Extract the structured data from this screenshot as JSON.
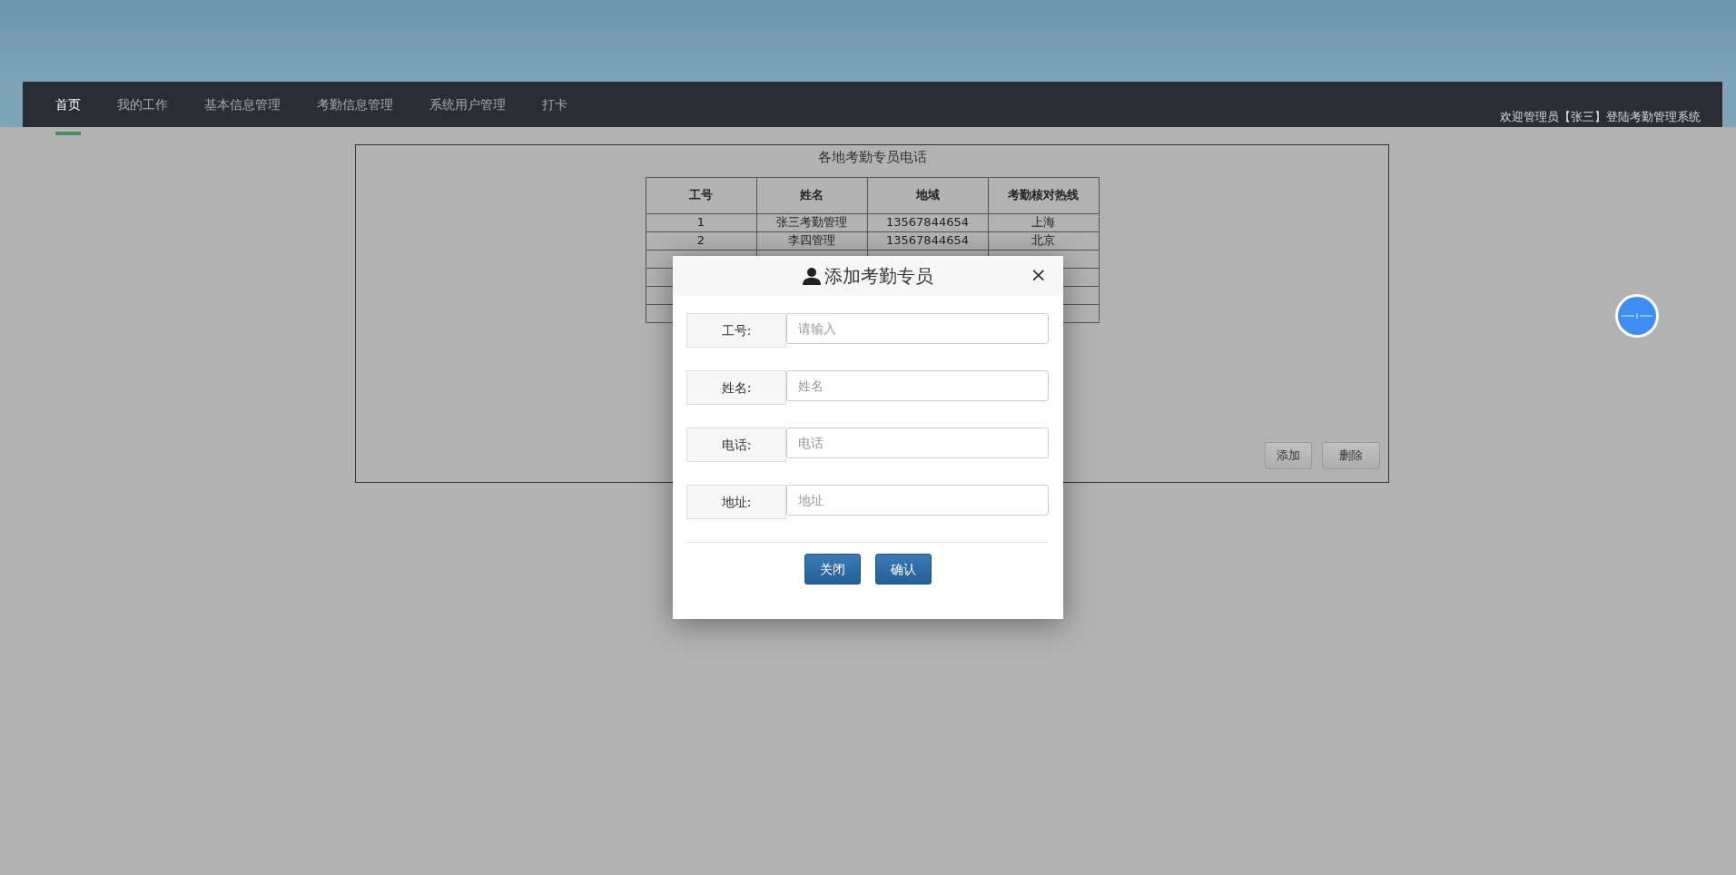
{
  "nav": {
    "items": [
      {
        "label": "首页",
        "selected": true
      },
      {
        "label": "我的工作",
        "selected": false
      },
      {
        "label": "基本信息管理",
        "selected": false
      },
      {
        "label": "考勤信息管理",
        "selected": false
      },
      {
        "label": "系统用户管理",
        "selected": false
      },
      {
        "label": "打卡",
        "selected": false
      }
    ],
    "welcome": "欢迎管理员【张三】登陆考勤管理系统"
  },
  "panel": {
    "title": "各地考勤专员电话",
    "table": {
      "columns": [
        "工号",
        "姓名",
        "地域",
        "考勤核对热线"
      ],
      "rows": [
        {
          "kind": "data",
          "cells": [
            "1",
            "张三考勤管理",
            "13567844654",
            "上海"
          ]
        },
        {
          "kind": "data",
          "cells": [
            "2",
            "李四管理",
            "13567844654",
            "北京"
          ]
        },
        {
          "kind": "blank"
        },
        {
          "kind": "blank"
        },
        {
          "kind": "blank"
        },
        {
          "kind": "blank"
        }
      ]
    },
    "buttons": [
      "添加",
      "删除"
    ]
  },
  "modal": {
    "title": "添加考勤专员",
    "close": "×",
    "fields": [
      {
        "label": "工号:",
        "placeholder": "请输入"
      },
      {
        "label": "姓名:",
        "placeholder": "姓名"
      },
      {
        "label": "电话:",
        "placeholder": "电话"
      },
      {
        "label": "地址:",
        "placeholder": "地址"
      }
    ],
    "buttons": [
      "关闭",
      "确认"
    ]
  }
}
